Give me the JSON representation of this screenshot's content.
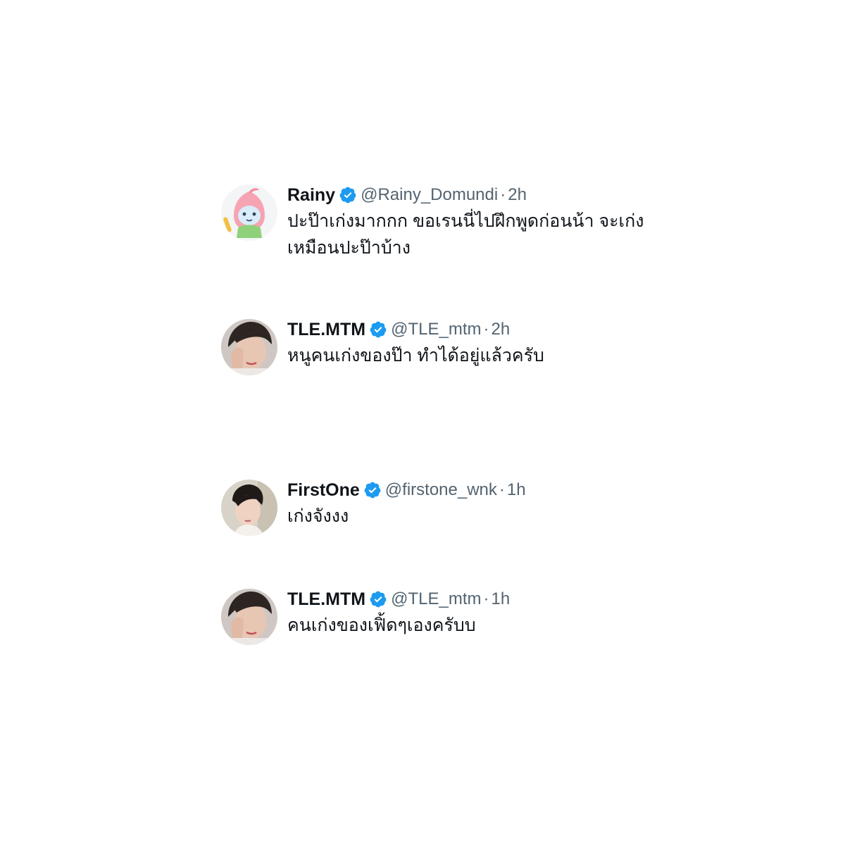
{
  "tweets": [
    {
      "display_name": "Rainy",
      "handle": "@Rainy_Domundi",
      "separator": "·",
      "time": "2h",
      "verified": true,
      "avatar_icon": "cartoon-mascot-avatar",
      "text_lines": [
        "ปะป๊าเก่งมากกก ขอเรนนี่ไปฝึกพูดก่อนน้า จะเก่ง",
        "เหมือนปะป๊าบ้าง"
      ]
    },
    {
      "display_name": "TLE.MTM",
      "handle": "@TLE_mtm",
      "separator": "·",
      "time": "2h",
      "verified": true,
      "avatar_icon": "person-photo-avatar",
      "text_lines": [
        "หนูคนเก่งของป๊า ทำได้อยู่แล้วครับ"
      ]
    },
    {
      "display_name": "FirstOne",
      "handle": "@firstone_wnk",
      "separator": "·",
      "time": "1h",
      "verified": true,
      "avatar_icon": "person-photo-avatar",
      "text_lines": [
        "เก่งจังงง"
      ]
    },
    {
      "display_name": "TLE.MTM",
      "handle": "@TLE_mtm",
      "separator": "·",
      "time": "1h",
      "verified": true,
      "avatar_icon": "person-photo-avatar",
      "text_lines": [
        "คนเก่งของเฟิ้ดๆเองครับบ"
      ]
    }
  ],
  "colors": {
    "verified_badge": "#1d9bf0",
    "name_text": "#0f1419",
    "secondary_text": "#536471",
    "background": "#ffffff"
  }
}
